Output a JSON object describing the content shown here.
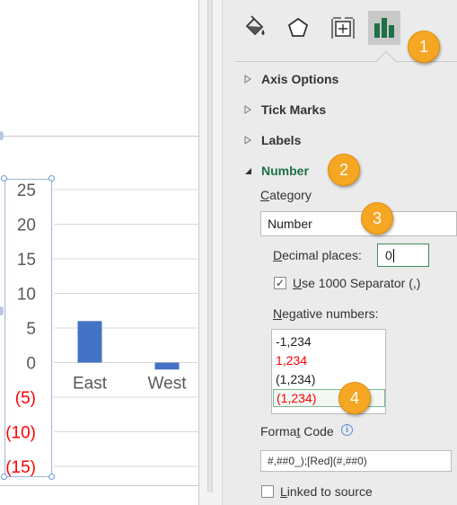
{
  "chart_data": {
    "type": "bar",
    "categories": [
      "East",
      "West"
    ],
    "values": [
      6,
      -1
    ],
    "ylim": [
      -15,
      25
    ],
    "y_ticks": [
      25,
      20,
      15,
      10,
      5,
      0,
      -5,
      -10,
      -15
    ],
    "y_tick_labels": [
      "25",
      "20",
      "15",
      "10",
      "5",
      "0",
      "(5)",
      "(10)",
      "(15)"
    ],
    "negative_color": "#ff0000",
    "bar_color": "#4472c4",
    "grid": true
  },
  "pane": {
    "tabs": [
      {
        "name": "fill-line-icon"
      },
      {
        "name": "effects-pentagon-icon"
      },
      {
        "name": "size-properties-icon"
      },
      {
        "name": "axis-options-bar-icon",
        "active": true
      }
    ],
    "sections": {
      "axis_options": "Axis Options",
      "tick_marks": "Tick Marks",
      "labels": "Labels",
      "number": "Number"
    },
    "category_label_pre": "",
    "category_label_u": "C",
    "category_label_post": "ategory",
    "category_value": "Number",
    "decimal_label_u": "D",
    "decimal_label_post": "ecimal places:",
    "decimal_value": "0",
    "use1000_label_u": "U",
    "use1000_label_post": "se 1000 Separator (,)",
    "use1000_checked": true,
    "negative_label_u": "N",
    "negative_label_post": "egative numbers:",
    "negative_options": [
      {
        "text": "-1,234",
        "color": "#222222"
      },
      {
        "text": "1,234",
        "color": "#ff0000"
      },
      {
        "text": "(1,234)",
        "color": "#222222"
      },
      {
        "text": "(1,234)",
        "color": "#ff0000",
        "selected": true
      }
    ],
    "format_code_label_pre": "Forma",
    "format_code_label_u": "t",
    "format_code_label_post": " Code",
    "format_code_value": "#,##0_);[Red](#,##0)",
    "info_icon": "i",
    "linked_label_u": "L",
    "linked_label_post": "inked to source",
    "linked_checked": false
  },
  "badges": [
    "1",
    "2",
    "3",
    "4"
  ],
  "colors": {
    "accent_green": "#1e7145",
    "badge_orange": "#f5a623"
  }
}
